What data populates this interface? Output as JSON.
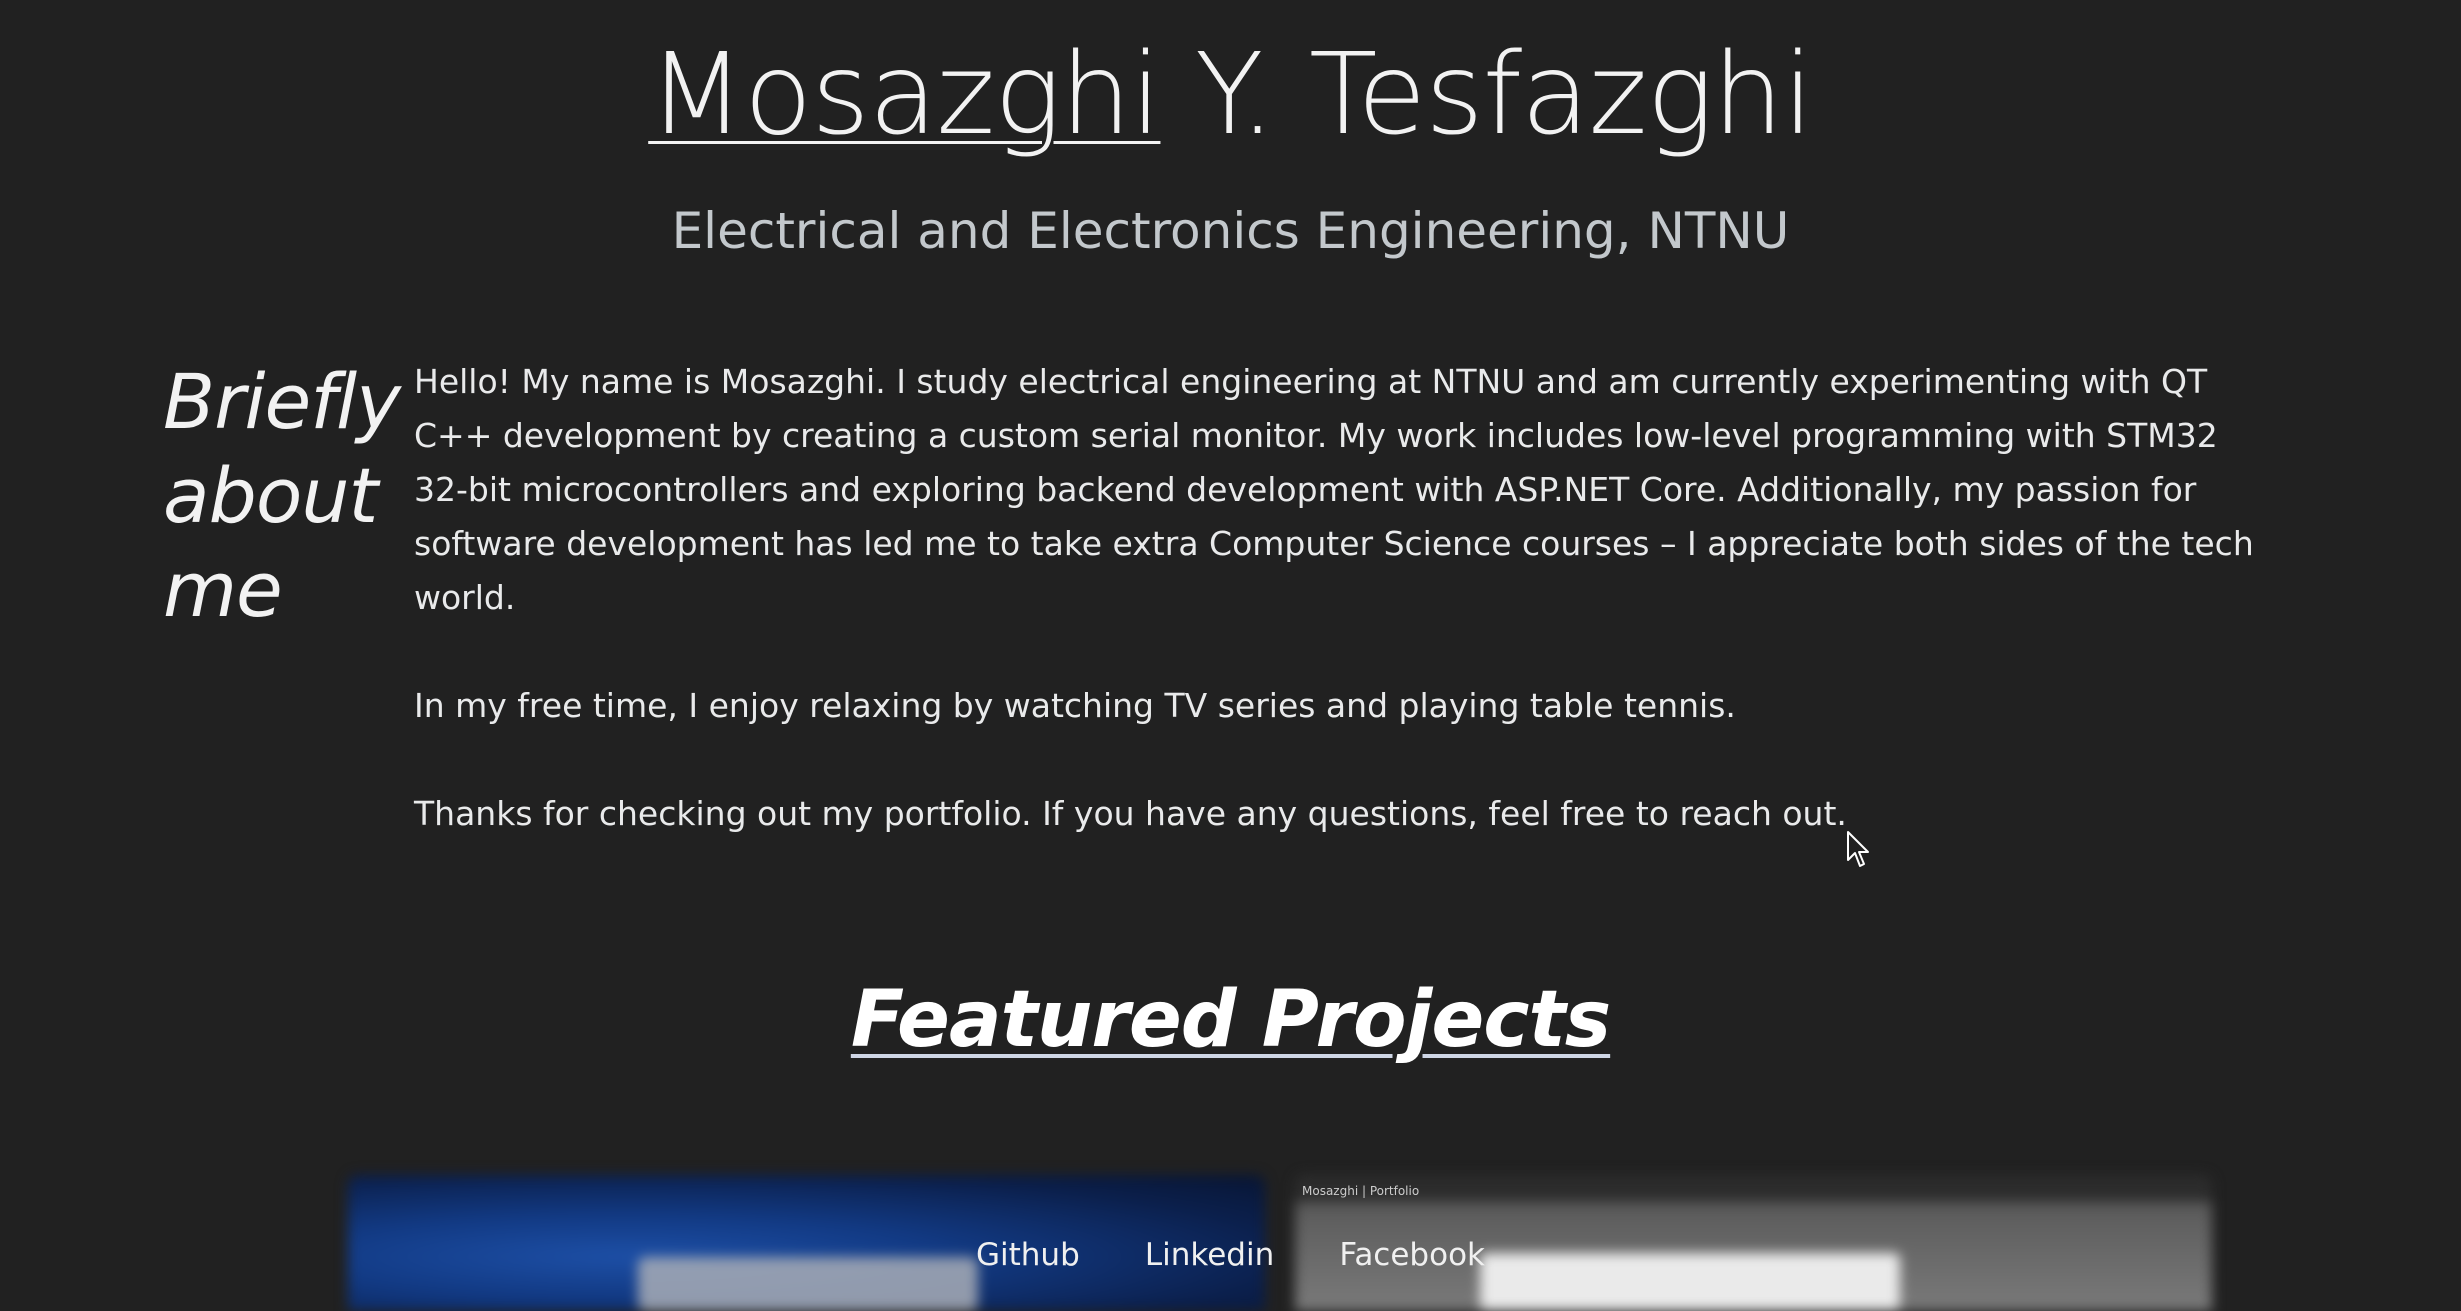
{
  "header": {
    "name_first": "Mosazghi",
    "name_rest": " Y. Tesfazghi",
    "subtitle": "Electrical and Electronics Engineering, NTNU"
  },
  "about": {
    "heading": "Briefly about me",
    "paragraphs": [
      "Hello! My name is Mosazghi. I study electrical engineering at NTNU and am currently experimenting with QT C++ development by creating a custom serial monitor. My work includes low-level programming with STM32 32-bit microcontrollers and exploring backend development with ASP.NET Core. Additionally, my passion for software development has led me to take extra Computer Science courses – I appreciate both sides of the tech world.",
      "In my free time, I enjoy relaxing by watching TV series and playing table tennis.",
      "Thanks for checking out my portfolio. If you have any questions, feel free to reach out."
    ]
  },
  "featured": {
    "heading": "Featured Projects",
    "browser_tab_label": "Mosazghi | Portfolio"
  },
  "footer": {
    "links": [
      "Github",
      "Linkedin",
      "Facebook"
    ]
  },
  "colors": {
    "background": "#212121",
    "text": "#f2f2f2",
    "subtitle": "#c3c8cc"
  },
  "icons": {
    "cursor": "mouse-pointer-icon"
  }
}
